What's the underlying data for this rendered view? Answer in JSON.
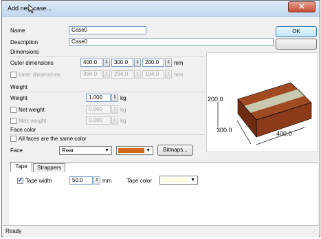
{
  "window": {
    "title": "Add new case..."
  },
  "name": {
    "label": "Name",
    "value": "Case0"
  },
  "description": {
    "label": "Description",
    "value": "Case0"
  },
  "buttons": {
    "ok": "OK",
    "cancel": ""
  },
  "dimensions": {
    "group": "Dimensions",
    "outer_label": "Outer dimensions",
    "outer": [
      "400.0",
      "300.0",
      "200.0"
    ],
    "unit": "mm",
    "inner_label": "Inner dimensions",
    "inner": [
      "394.0",
      "294.0",
      "194.0"
    ],
    "inner_checked": false
  },
  "weight": {
    "group": "Weight",
    "weight_label": "Weight",
    "weight_value": "1.000",
    "net_label": "Net weight",
    "net_value": "0.000",
    "max_label": "Max weight",
    "max_value": "0.000",
    "unit": "kg"
  },
  "face_color": {
    "group": "Face color",
    "all_same_label": "All faces are the same color",
    "face_label": "Face",
    "face_value": "Rear",
    "color": "#d2691e",
    "bitmaps_label": "Bitmaps..."
  },
  "preview": {
    "dim_labels": [
      "200.0",
      "300.0",
      "400.0"
    ],
    "box_color": "#8b3a1a",
    "tape_color": "#c9c9b0"
  },
  "tabs": [
    {
      "label": "Tape"
    },
    {
      "label": "Strappers"
    }
  ],
  "tape": {
    "width_label": "Tape width",
    "width_value": "50.0",
    "width_unit": "mm",
    "width_checked": true,
    "color_label": "Tape color",
    "color_value": "#ffffe0"
  },
  "status": {
    "text": "Ready"
  }
}
